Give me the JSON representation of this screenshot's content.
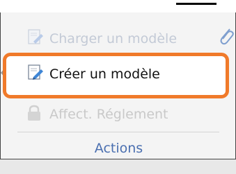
{
  "menu": {
    "load_template": "Charger un modèle",
    "create_template": "Créer un modèle",
    "assign_rule": "Affect. Réglement"
  },
  "group_label": "Actions",
  "icons": {
    "load": "document-pen-icon",
    "create": "document-pen-icon",
    "assign": "lock-icon",
    "attach": "paperclip-icon"
  },
  "colors": {
    "highlight": "#f07a2a",
    "group_label": "#4a6fb0"
  }
}
